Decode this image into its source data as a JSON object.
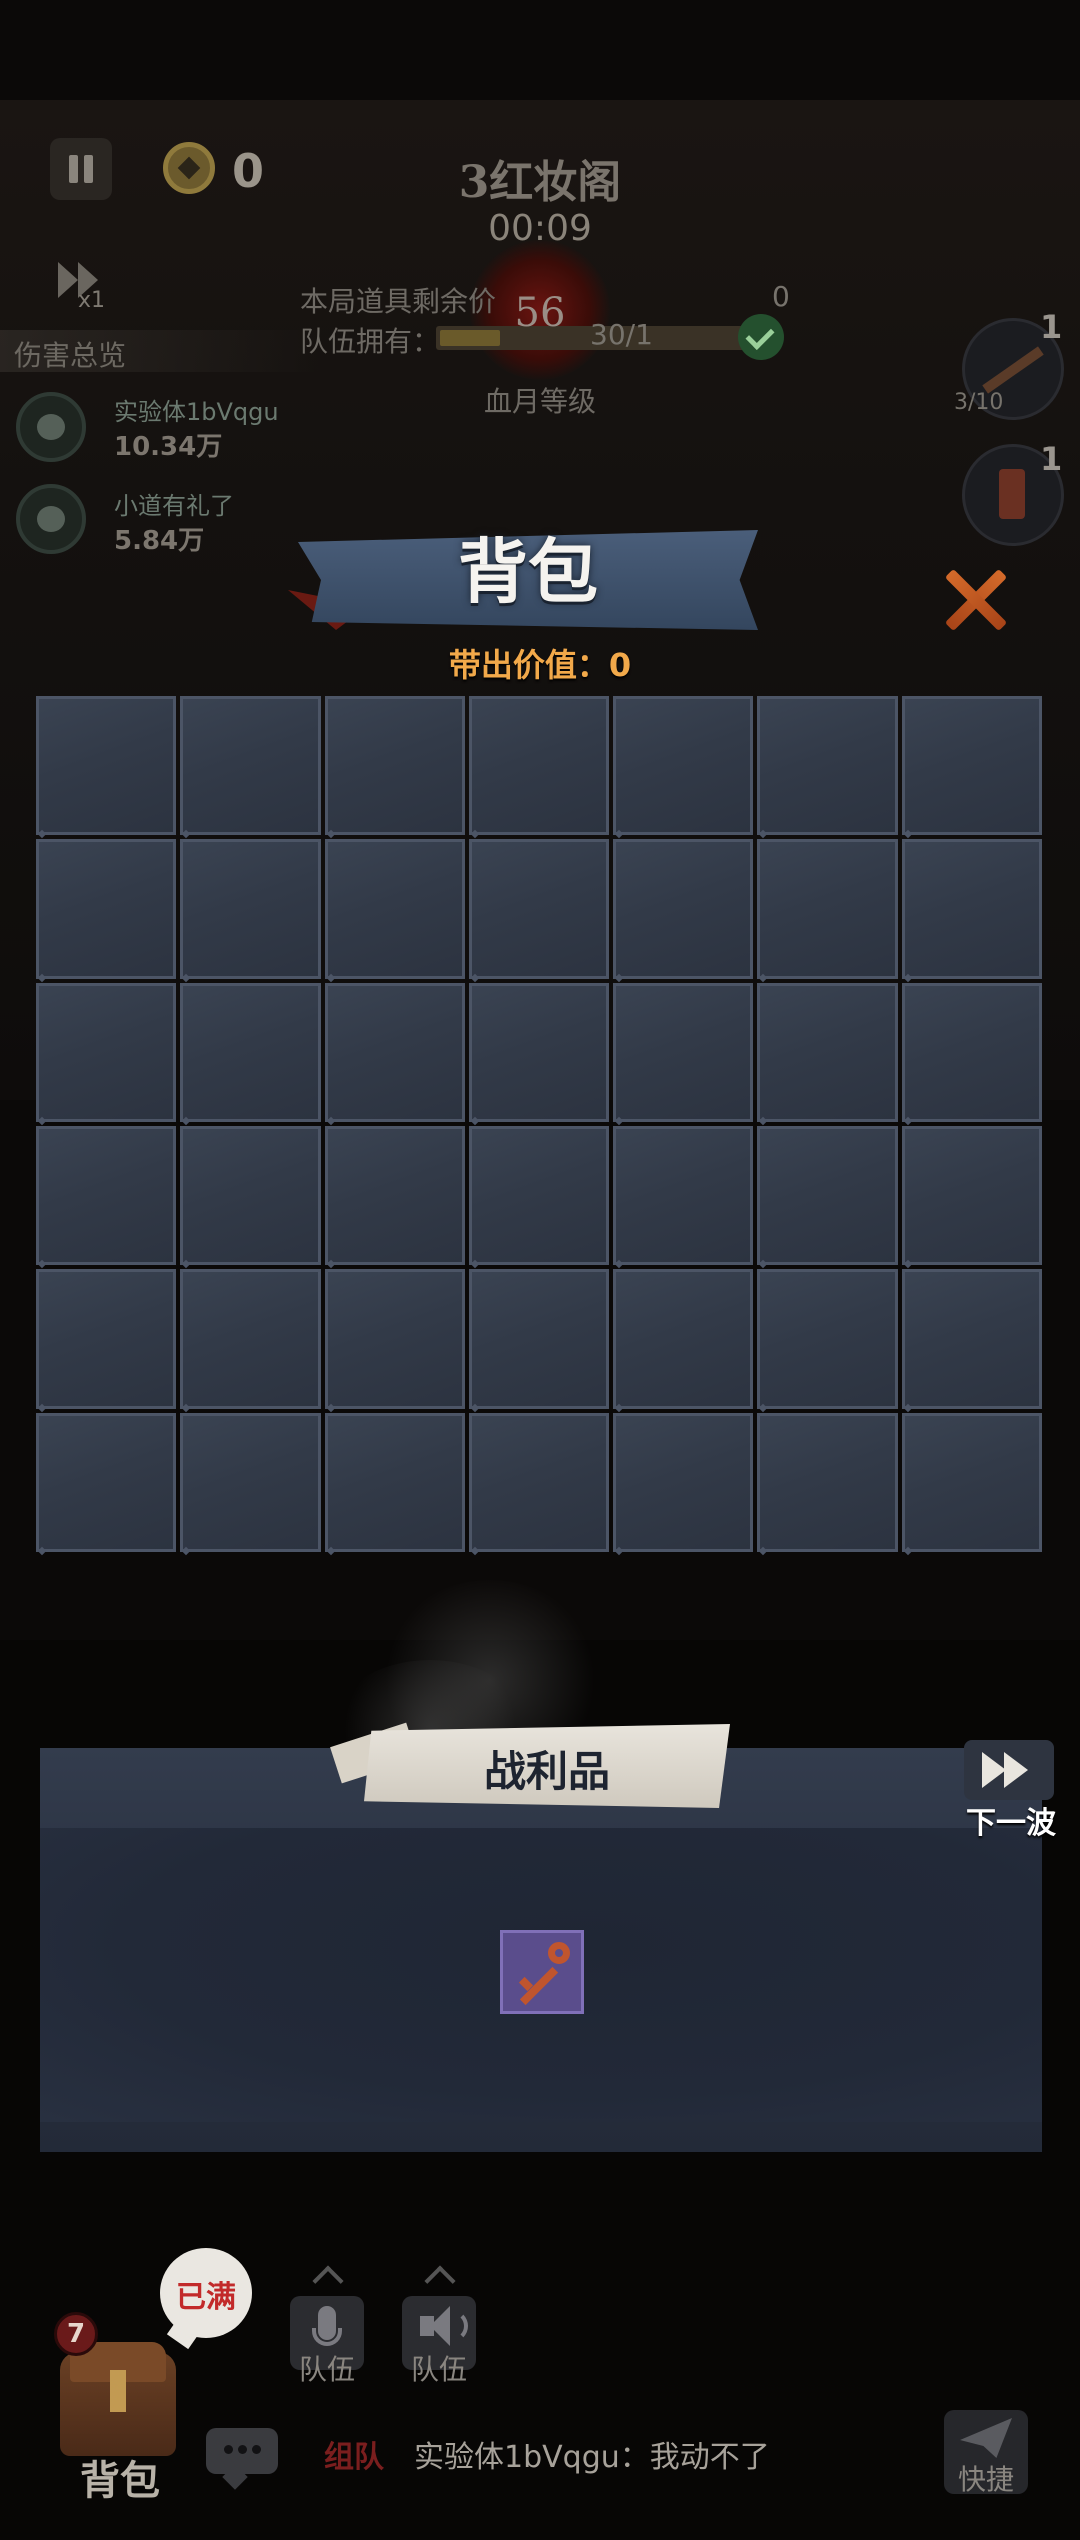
{
  "hud": {
    "coins": "0",
    "stage_name": "3红妆阁",
    "timer": "00:09",
    "speed_label": "x1",
    "damage_overview_title": "伤害总览",
    "players": [
      {
        "name": "实验体1bVqgu",
        "damage": "10.34万"
      },
      {
        "name": "小道有礼了",
        "damage": "5.84万"
      }
    ],
    "item_value_label": "本局道具剩余价",
    "item_value_count": "0",
    "team_own_label": "队伍拥有：",
    "team_progress_text": "30/1",
    "team_progress": 0.2,
    "blood_moon_level": "56",
    "blood_moon_label": "血月等级",
    "weapon_count": "1",
    "weapon_ammo": "3/10",
    "consumable_count": "1"
  },
  "backpack": {
    "title": "背包",
    "carry_value": "带出价值：0",
    "columns": 7,
    "rows": 6
  },
  "loot": {
    "title": "战利品",
    "next_wave_label": "下一波",
    "items": [
      {
        "icon": "key-icon",
        "color": "#c0552e",
        "rarity_color": "#5a4d8c"
      }
    ]
  },
  "bottom": {
    "bag_badge_count": "7",
    "bag_label": "背包",
    "full_label": "已满",
    "mic_label": "队伍",
    "speaker_label": "队伍",
    "chat_channel": "组队",
    "chat_message": "实验体1bVqgu：我动不了",
    "quick_label": "快捷"
  },
  "colors": {
    "accent_orange": "#f2a94a",
    "close_orange": "#d46a2a",
    "cell_border": "#4c5566",
    "panel_blue": "#34465e"
  }
}
